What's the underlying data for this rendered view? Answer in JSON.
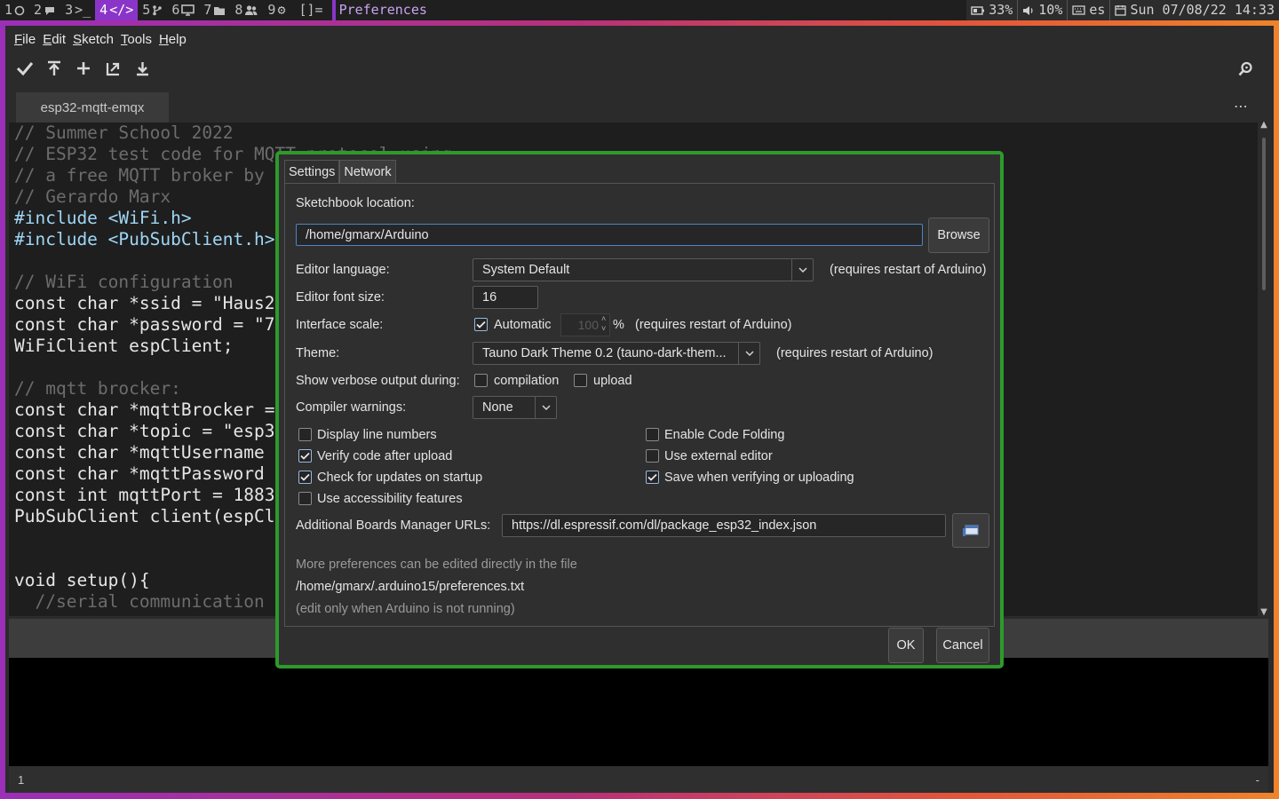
{
  "topbar": {
    "workspaces": [
      {
        "num": "1",
        "icon": "circle-icon",
        "active": false
      },
      {
        "num": "2",
        "icon": "chat-icon",
        "active": false
      },
      {
        "num": "3",
        "icon": "terminal-icon",
        "active": false
      },
      {
        "num": "4",
        "icon": "code-icon",
        "active": true
      },
      {
        "num": "5",
        "icon": "git-branch-icon",
        "active": false
      },
      {
        "num": "6",
        "icon": "monitor-icon",
        "active": false
      },
      {
        "num": "7",
        "icon": "folder-icon",
        "active": false
      },
      {
        "num": "8",
        "icon": "users-icon",
        "active": false
      },
      {
        "num": "9",
        "icon": "gear-icon",
        "active": false
      }
    ],
    "layout_indicator": "[]=",
    "window_title": "Preferences",
    "battery": "33%",
    "volume": "10%",
    "keyboard": "es",
    "datetime": "Sun 07/08/22 14:33"
  },
  "app": {
    "menu": [
      "File",
      "Edit",
      "Sketch",
      "Tools",
      "Help"
    ],
    "toolbar": [
      "verify-icon",
      "upload-icon",
      "new-icon",
      "open-icon",
      "save-icon"
    ],
    "tab_name": "esp32-mqtt-emqx",
    "tab_menu": "⋯",
    "line_indicator": "1",
    "board_indicator": "-",
    "code": [
      "// Summer School 2022",
      "// ESP32 test code for MQTT protocol using",
      "// a free MQTT broker by",
      "// Gerardo Marx",
      "#include <WiFi.h>",
      "#include <PubSubClient.h>",
      "",
      "// WiFi configuration",
      "const char *ssid = \"Haus2",
      "const char *password = \"7",
      "WiFiClient espClient;",
      "",
      "// mqtt brocker:",
      "const char *mqttBrocker =",
      "const char *topic = \"esp3",
      "const char *mqttUsername",
      "const char *mqttPassword",
      "const int mqttPort = 1883",
      "PubSubClient client(espCl",
      "",
      "",
      "void setup(){",
      "  //serial communication"
    ]
  },
  "prefs": {
    "tabs": [
      "Settings",
      "Network"
    ],
    "sketchbook_label": "Sketchbook location:",
    "sketchbook_value": "/home/gmarx/Arduino",
    "browse_label": "Browse",
    "language_label": "Editor language:",
    "language_value": "System Default",
    "restart_note": "(requires restart of Arduino)",
    "font_size_label": "Editor font size:",
    "font_size_value": "16",
    "scale_label": "Interface scale:",
    "scale_auto_label": "Automatic",
    "scale_value": "100",
    "scale_unit": "%",
    "theme_label": "Theme:",
    "theme_value": "Tauno Dark Theme 0.2 (tauno-dark-them...",
    "verbose_label": "Show verbose output during:",
    "compilation_label": "compilation",
    "upload_label": "upload",
    "warnings_label": "Compiler warnings:",
    "warnings_value": "None",
    "options": [
      {
        "label": "Display line numbers",
        "checked": false
      },
      {
        "label": "Enable Code Folding",
        "checked": false
      },
      {
        "label": "Verify code after upload",
        "checked": true
      },
      {
        "label": "Use external editor",
        "checked": false
      },
      {
        "label": "Check for updates on startup",
        "checked": true
      },
      {
        "label": "Save when verifying or uploading",
        "checked": true
      },
      {
        "label": "Use accessibility features",
        "checked": false
      }
    ],
    "boards_label": "Additional Boards Manager URLs:",
    "boards_value": "https://dl.espressif.com/dl/package_esp32_index.json",
    "more_prefs_note": "More preferences can be edited directly in the file",
    "prefs_path": "/home/gmarx/.arduino15/preferences.txt",
    "edit_note": "(edit only when Arduino is not running)",
    "ok_label": "OK",
    "cancel_label": "Cancel",
    "colors": {
      "dialog_border": "#2e9a2a",
      "focus": "#4a86c8",
      "workspace_active": "#8a35c8"
    }
  }
}
